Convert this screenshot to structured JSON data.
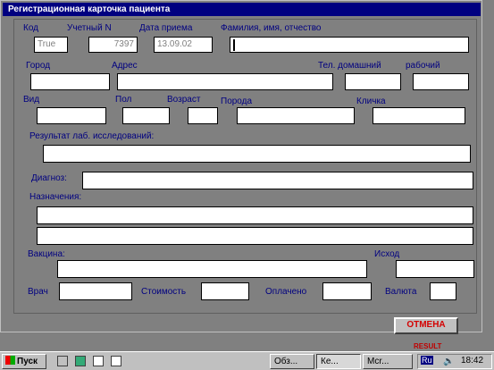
{
  "window": {
    "title": "Регистрационная карточка пациента"
  },
  "fields": {
    "kod": {
      "label": "Код",
      "value": "True"
    },
    "uchet": {
      "label": "Учетный N",
      "value": "7397"
    },
    "data_priema": {
      "label": "Дата приема",
      "value": "13.09.02"
    },
    "fio": {
      "label": "Фамилия, имя, отчество",
      "value": ""
    },
    "gorod": {
      "label": "Город",
      "value": ""
    },
    "adres": {
      "label": "Адрес",
      "value": ""
    },
    "tel_dom": {
      "label": "Тел. домашний",
      "value": ""
    },
    "tel_rab": {
      "label": "рабочий",
      "value": ""
    },
    "vid": {
      "label": "Вид",
      "value": ""
    },
    "pol": {
      "label": "Пол",
      "value": ""
    },
    "vozrast": {
      "label": "Возраст",
      "value": ""
    },
    "poroda": {
      "label": "Порода",
      "value": ""
    },
    "klichka": {
      "label": "Кличка",
      "value": ""
    },
    "rezultat": {
      "label": "Результат лаб. исследований:",
      "value": ""
    },
    "diagnoz": {
      "label": "Диагноз:",
      "value": ""
    },
    "naznacheniya": {
      "label": "Назначения:",
      "value1": "",
      "value2": ""
    },
    "vakcina": {
      "label": "Вакцина:",
      "value": ""
    },
    "ishod": {
      "label": "Исход",
      "value": ""
    },
    "vrach": {
      "label": "Врач",
      "value": ""
    },
    "stoimost": {
      "label": "Стоимость",
      "value": ""
    },
    "oplacheno": {
      "label": "Оплачено",
      "value": ""
    },
    "valuta": {
      "label": "Валюта",
      "value": ""
    }
  },
  "buttons": {
    "cancel": "ОТМЕНА"
  },
  "note": "RESULT",
  "taskbar": {
    "start": "Пуск",
    "tasks": [
      "Обз...",
      "Ке...",
      "Mcr..."
    ],
    "lang": "Ru",
    "clock": "18:42"
  },
  "colors": {
    "title_bg": "#000080",
    "label": "#000080",
    "cancel_text": "#d40000"
  }
}
